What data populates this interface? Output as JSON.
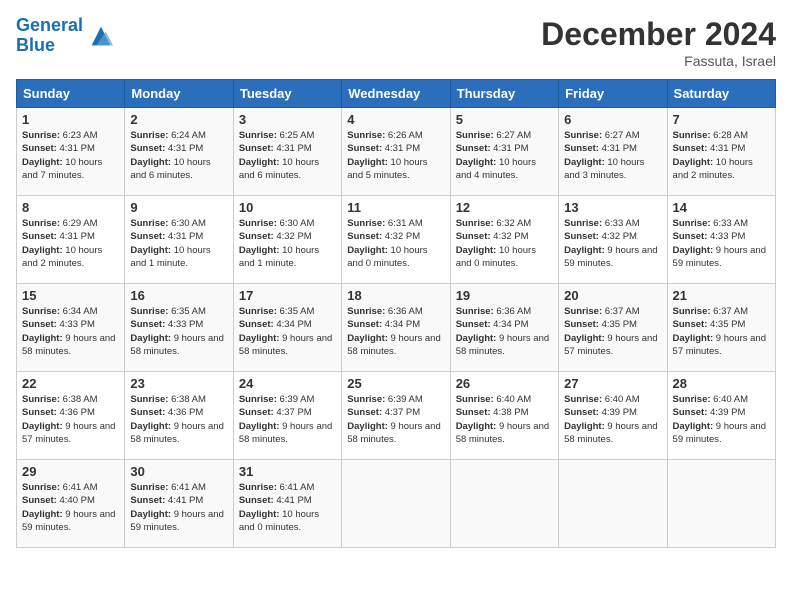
{
  "header": {
    "logo_line1": "General",
    "logo_line2": "Blue",
    "month_title": "December 2024",
    "location": "Fassuta, Israel"
  },
  "days_of_week": [
    "Sunday",
    "Monday",
    "Tuesday",
    "Wednesday",
    "Thursday",
    "Friday",
    "Saturday"
  ],
  "weeks": [
    [
      {
        "day": 1,
        "sunrise": "6:23 AM",
        "sunset": "4:31 PM",
        "daylight": "10 hours and 7 minutes."
      },
      {
        "day": 2,
        "sunrise": "6:24 AM",
        "sunset": "4:31 PM",
        "daylight": "10 hours and 6 minutes."
      },
      {
        "day": 3,
        "sunrise": "6:25 AM",
        "sunset": "4:31 PM",
        "daylight": "10 hours and 6 minutes."
      },
      {
        "day": 4,
        "sunrise": "6:26 AM",
        "sunset": "4:31 PM",
        "daylight": "10 hours and 5 minutes."
      },
      {
        "day": 5,
        "sunrise": "6:27 AM",
        "sunset": "4:31 PM",
        "daylight": "10 hours and 4 minutes."
      },
      {
        "day": 6,
        "sunrise": "6:27 AM",
        "sunset": "4:31 PM",
        "daylight": "10 hours and 3 minutes."
      },
      {
        "day": 7,
        "sunrise": "6:28 AM",
        "sunset": "4:31 PM",
        "daylight": "10 hours and 2 minutes."
      }
    ],
    [
      {
        "day": 8,
        "sunrise": "6:29 AM",
        "sunset": "4:31 PM",
        "daylight": "10 hours and 2 minutes."
      },
      {
        "day": 9,
        "sunrise": "6:30 AM",
        "sunset": "4:31 PM",
        "daylight": "10 hours and 1 minute."
      },
      {
        "day": 10,
        "sunrise": "6:30 AM",
        "sunset": "4:32 PM",
        "daylight": "10 hours and 1 minute."
      },
      {
        "day": 11,
        "sunrise": "6:31 AM",
        "sunset": "4:32 PM",
        "daylight": "10 hours and 0 minutes."
      },
      {
        "day": 12,
        "sunrise": "6:32 AM",
        "sunset": "4:32 PM",
        "daylight": "10 hours and 0 minutes."
      },
      {
        "day": 13,
        "sunrise": "6:33 AM",
        "sunset": "4:32 PM",
        "daylight": "9 hours and 59 minutes."
      },
      {
        "day": 14,
        "sunrise": "6:33 AM",
        "sunset": "4:33 PM",
        "daylight": "9 hours and 59 minutes."
      }
    ],
    [
      {
        "day": 15,
        "sunrise": "6:34 AM",
        "sunset": "4:33 PM",
        "daylight": "9 hours and 58 minutes."
      },
      {
        "day": 16,
        "sunrise": "6:35 AM",
        "sunset": "4:33 PM",
        "daylight": "9 hours and 58 minutes."
      },
      {
        "day": 17,
        "sunrise": "6:35 AM",
        "sunset": "4:34 PM",
        "daylight": "9 hours and 58 minutes."
      },
      {
        "day": 18,
        "sunrise": "6:36 AM",
        "sunset": "4:34 PM",
        "daylight": "9 hours and 58 minutes."
      },
      {
        "day": 19,
        "sunrise": "6:36 AM",
        "sunset": "4:34 PM",
        "daylight": "9 hours and 58 minutes."
      },
      {
        "day": 20,
        "sunrise": "6:37 AM",
        "sunset": "4:35 PM",
        "daylight": "9 hours and 57 minutes."
      },
      {
        "day": 21,
        "sunrise": "6:37 AM",
        "sunset": "4:35 PM",
        "daylight": "9 hours and 57 minutes."
      }
    ],
    [
      {
        "day": 22,
        "sunrise": "6:38 AM",
        "sunset": "4:36 PM",
        "daylight": "9 hours and 57 minutes."
      },
      {
        "day": 23,
        "sunrise": "6:38 AM",
        "sunset": "4:36 PM",
        "daylight": "9 hours and 58 minutes."
      },
      {
        "day": 24,
        "sunrise": "6:39 AM",
        "sunset": "4:37 PM",
        "daylight": "9 hours and 58 minutes."
      },
      {
        "day": 25,
        "sunrise": "6:39 AM",
        "sunset": "4:37 PM",
        "daylight": "9 hours and 58 minutes."
      },
      {
        "day": 26,
        "sunrise": "6:40 AM",
        "sunset": "4:38 PM",
        "daylight": "9 hours and 58 minutes."
      },
      {
        "day": 27,
        "sunrise": "6:40 AM",
        "sunset": "4:39 PM",
        "daylight": "9 hours and 58 minutes."
      },
      {
        "day": 28,
        "sunrise": "6:40 AM",
        "sunset": "4:39 PM",
        "daylight": "9 hours and 59 minutes."
      }
    ],
    [
      {
        "day": 29,
        "sunrise": "6:41 AM",
        "sunset": "4:40 PM",
        "daylight": "9 hours and 59 minutes."
      },
      {
        "day": 30,
        "sunrise": "6:41 AM",
        "sunset": "4:41 PM",
        "daylight": "9 hours and 59 minutes."
      },
      {
        "day": 31,
        "sunrise": "6:41 AM",
        "sunset": "4:41 PM",
        "daylight": "10 hours and 0 minutes."
      },
      null,
      null,
      null,
      null
    ]
  ],
  "labels": {
    "sunrise": "Sunrise: ",
    "sunset": "Sunset: ",
    "daylight": "Daylight: "
  }
}
